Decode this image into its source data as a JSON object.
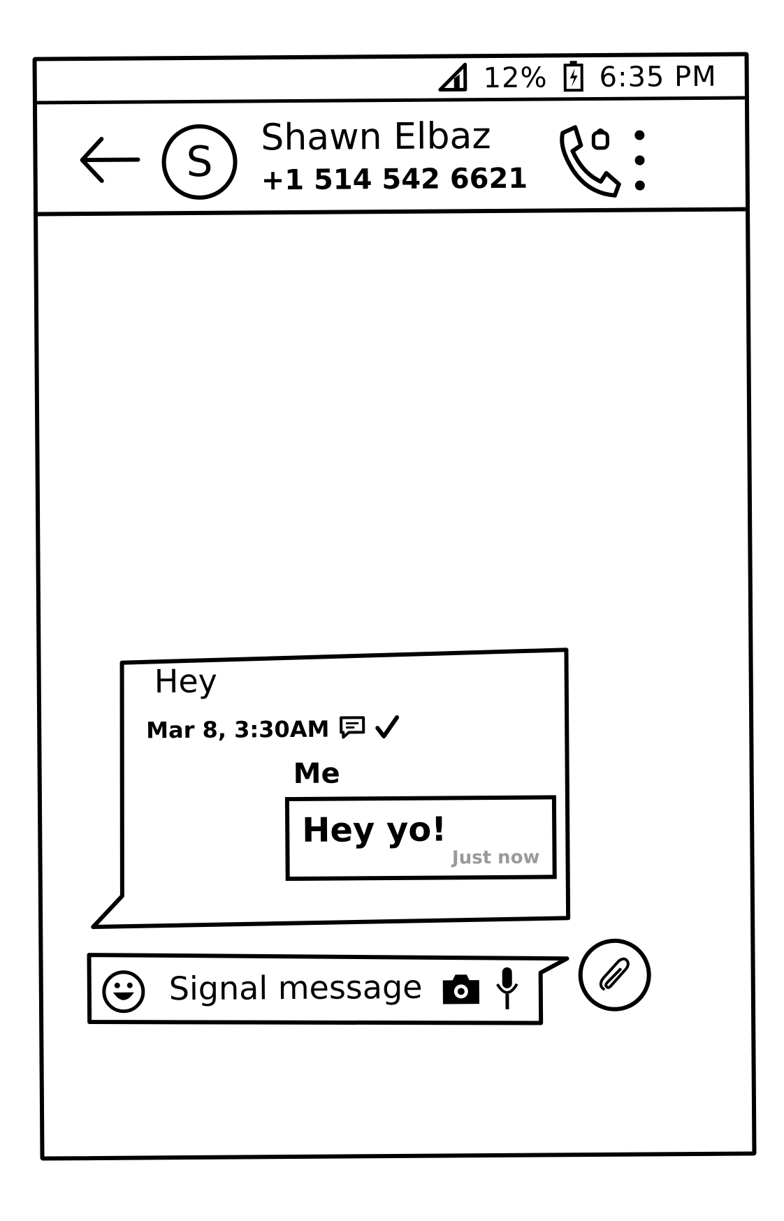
{
  "status_bar": {
    "battery_percent": "12%",
    "time": "6:35 PM",
    "icons": [
      "signal-icon",
      "battery-charging-icon"
    ]
  },
  "header": {
    "avatar_initial": "S",
    "contact_name": "Shawn Elbaz",
    "contact_phone": "+1 514 542 6621",
    "icons": [
      "back-arrow-icon",
      "secure-call-icon",
      "more-vert-icon"
    ]
  },
  "conversation": {
    "incoming": {
      "text": "Hey",
      "timestamp": "Mar 8, 3:30AM",
      "icons": [
        "message-icon",
        "check-icon"
      ]
    },
    "outgoing": {
      "sender": "Me",
      "text": "Hey yo!",
      "timestamp": "Just now",
      "timestamp_color": "#9a9a9a"
    }
  },
  "composer": {
    "placeholder": "Signal message",
    "icons": [
      "emoji-icon",
      "camera-icon",
      "mic-icon",
      "attach-icon"
    ]
  }
}
